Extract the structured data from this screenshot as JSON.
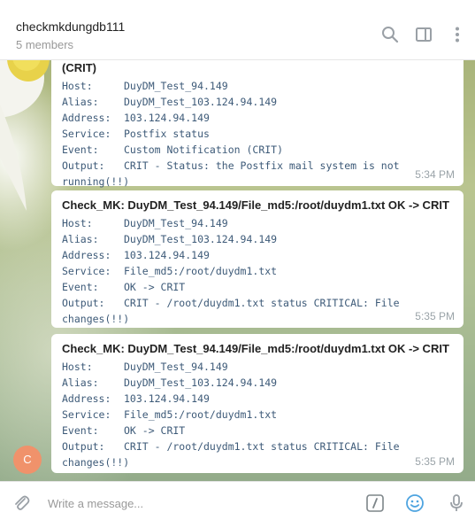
{
  "header": {
    "title": "checkmkdungdb111",
    "subtitle": "5 members",
    "icons": [
      "search-icon",
      "sidebar-toggle-icon",
      "more-vertical-icon"
    ]
  },
  "messages": [
    {
      "title": "(CRIT)",
      "rows": [
        {
          "key": "Host:",
          "value": "DuyDM_Test_94.149"
        },
        {
          "key": "Alias:",
          "value": "DuyDM_Test_103.124.94.149"
        },
        {
          "key": "Address:",
          "value": "103.124.94.149"
        },
        {
          "key": "Service:",
          "value": "Postfix status"
        },
        {
          "key": "Event:",
          "value": "Custom Notification (CRIT)"
        },
        {
          "key": "Output:",
          "value": "CRIT - Status: the Postfix mail system is not"
        },
        {
          "key": "",
          "value": "running(!!)"
        }
      ],
      "time": "5:34 PM"
    },
    {
      "title": "Check_MK: DuyDM_Test_94.149/File_md5:/root/duydm1.txt OK -> CRIT",
      "rows": [
        {
          "key": "Host:",
          "value": "DuyDM_Test_94.149"
        },
        {
          "key": "Alias:",
          "value": "DuyDM_Test_103.124.94.149"
        },
        {
          "key": "Address:",
          "value": "103.124.94.149"
        },
        {
          "key": "Service:",
          "value": "File_md5:/root/duydm1.txt"
        },
        {
          "key": "Event:",
          "value": "OK -> CRIT"
        },
        {
          "key": "Output:",
          "value": "CRIT - /root/duydm1.txt status CRITICAL: File"
        },
        {
          "key": "",
          "value": "changes(!!)"
        }
      ],
      "time": "5:35 PM"
    },
    {
      "title": "Check_MK: DuyDM_Test_94.149/File_md5:/root/duydm1.txt OK -> CRIT",
      "rows": [
        {
          "key": "Host:",
          "value": "DuyDM_Test_94.149"
        },
        {
          "key": "Alias:",
          "value": "DuyDM_Test_103.124.94.149"
        },
        {
          "key": "Address:",
          "value": "103.124.94.149"
        },
        {
          "key": "Service:",
          "value": "File_md5:/root/duydm1.txt"
        },
        {
          "key": "Event:",
          "value": "OK -> CRIT"
        },
        {
          "key": "Output:",
          "value": "CRIT - /root/duydm1.txt status CRITICAL: File"
        },
        {
          "key": "",
          "value": "changes(!!)"
        }
      ],
      "time": "5:35 PM"
    }
  ],
  "sender": {
    "avatar_letter": "C",
    "avatar_color": "#f0926b"
  },
  "composer": {
    "placeholder": "Write a message...",
    "icons": [
      "attach-icon",
      "command-icon",
      "emoji-icon",
      "microphone-icon"
    ]
  }
}
